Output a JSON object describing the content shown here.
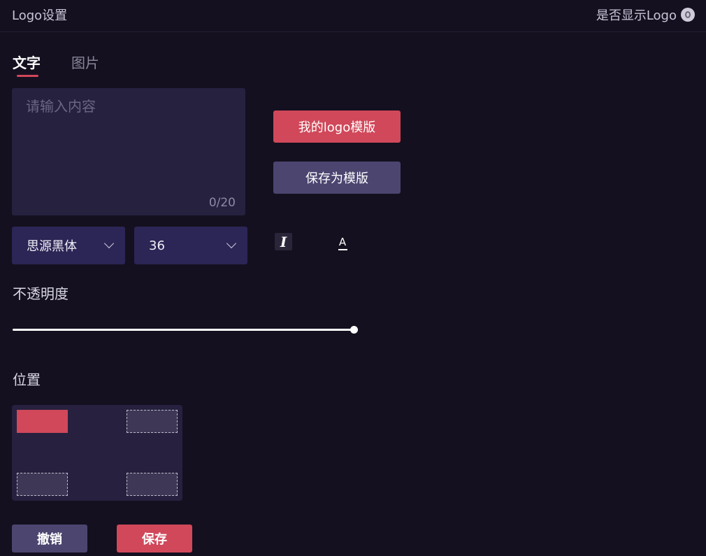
{
  "header": {
    "title": "Logo设置",
    "toggle_label": "是否显示Logo"
  },
  "tabs": [
    {
      "label": "文字",
      "active": true
    },
    {
      "label": "图片",
      "active": false
    }
  ],
  "text_input": {
    "value": "",
    "placeholder": "请输入内容",
    "counter": "0/20"
  },
  "buttons": {
    "my_template": "我的logo模版",
    "save_as_template": "保存为模版",
    "cancel": "撤销",
    "save": "保存"
  },
  "font_select": {
    "value": "思源黑体"
  },
  "size_select": {
    "value": "36"
  },
  "format_icons": {
    "italic": "I",
    "font_color": "A"
  },
  "opacity": {
    "label": "不透明度",
    "value": 1.0
  },
  "position": {
    "label": "位置",
    "options": [
      "top-left",
      "top-right",
      "bottom-left",
      "bottom-right"
    ],
    "selected": "top-left"
  },
  "colors": {
    "accent": "#d0485a",
    "secondary_button": "#4c4570",
    "background": "#14101f",
    "panel": "#26213f"
  }
}
